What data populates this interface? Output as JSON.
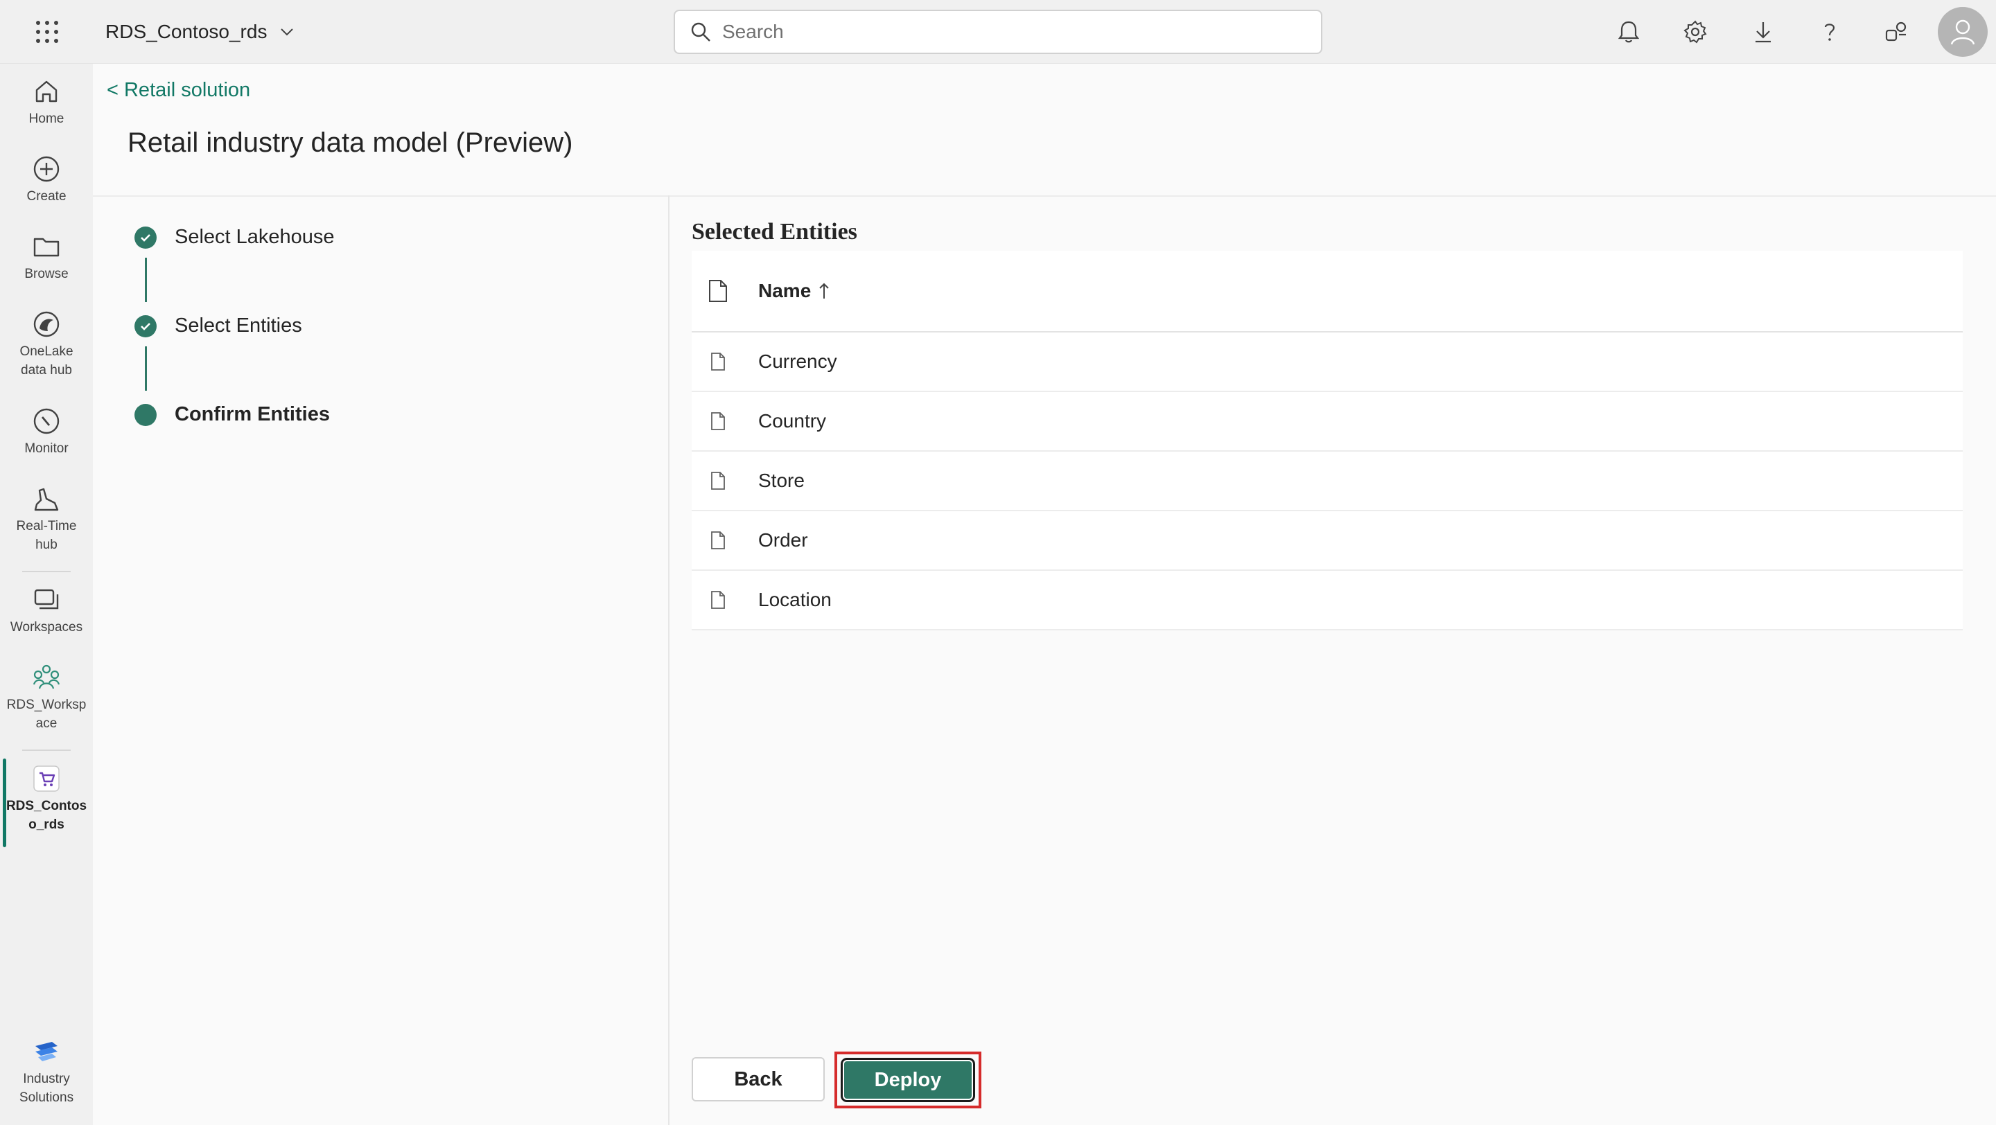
{
  "topbar": {
    "workspace_name": "RDS_Contoso_rds",
    "search_placeholder": "Search"
  },
  "leftnav": {
    "items": [
      {
        "label": "Home",
        "icon": "home-icon"
      },
      {
        "label": "Create",
        "icon": "plus-circle-icon"
      },
      {
        "label": "Browse",
        "icon": "folder-icon"
      },
      {
        "label": "OneLake data hub",
        "icon": "onelake-icon"
      },
      {
        "label": "Monitor",
        "icon": "monitor-icon"
      },
      {
        "label": "Real-Time hub",
        "icon": "realtime-hub-icon"
      },
      {
        "label": "Workspaces",
        "icon": "workspaces-icon"
      },
      {
        "label": "RDS_Workspace",
        "icon": "workspace-people-icon"
      },
      {
        "label": "RDS_Contoso_rds",
        "icon": "retail-cart-icon"
      },
      {
        "label": "Industry Solutions",
        "icon": "industry-solutions-icon"
      }
    ],
    "active": "RDS_Contoso_rds"
  },
  "main": {
    "back_link": "< Retail solution",
    "title": "Retail industry data model (Preview)",
    "steps": [
      {
        "label": "Select Lakehouse",
        "status": "done"
      },
      {
        "label": "Select Entities",
        "status": "done"
      },
      {
        "label": "Confirm Entities",
        "status": "current"
      }
    ],
    "selected_title": "Selected Entities",
    "table": {
      "column_name": "Name",
      "sort": "ascending",
      "rows": [
        "Currency",
        "Country",
        "Store",
        "Order",
        "Location"
      ]
    },
    "buttons": {
      "back": "Back",
      "deploy": "Deploy"
    }
  },
  "colors": {
    "accent": "#117865",
    "step": "#2f7866",
    "highlight": "#d52b2b"
  }
}
